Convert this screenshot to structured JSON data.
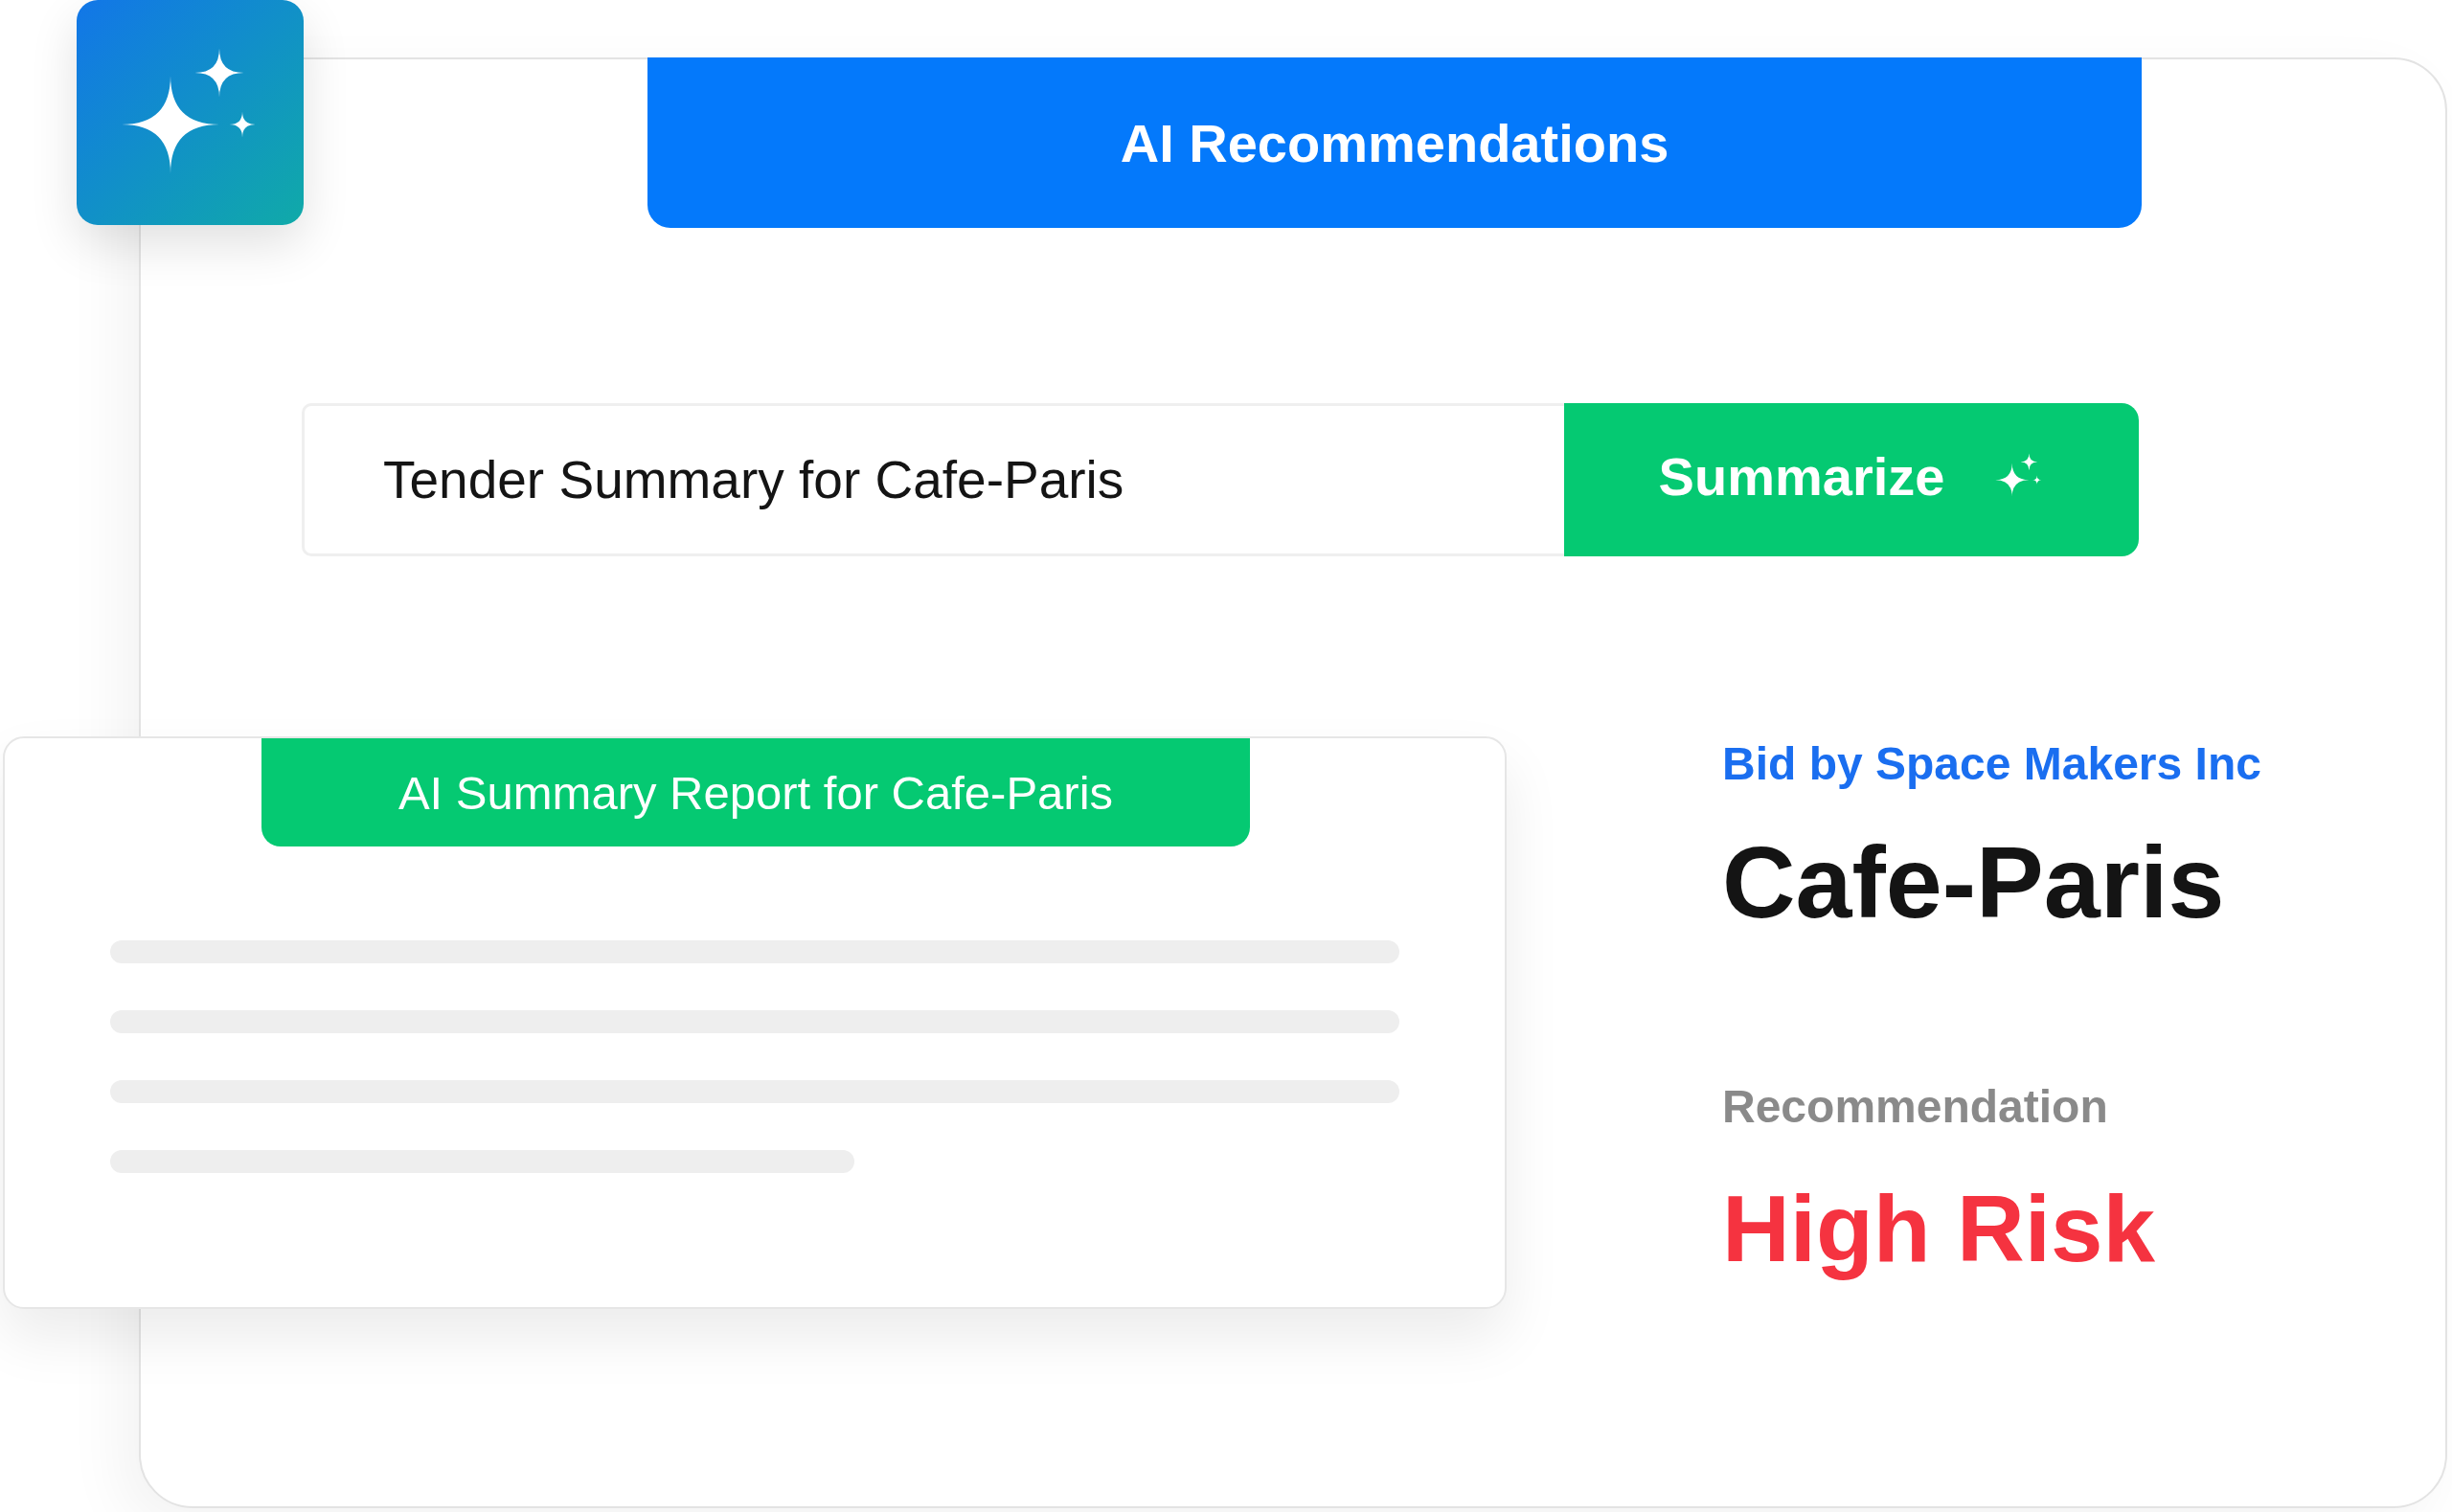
{
  "header": {
    "title": "AI Recommendations"
  },
  "search": {
    "value": "Tender Summary for Cafe-Paris"
  },
  "summarize_button": {
    "label": "Summarize"
  },
  "report": {
    "title": "AI Summary Report for Cafe-Paris"
  },
  "bid": {
    "subtitle": "Bid by Space Makers Inc",
    "project": "Cafe-Paris",
    "label": "Recommendation",
    "value": "High Risk"
  }
}
